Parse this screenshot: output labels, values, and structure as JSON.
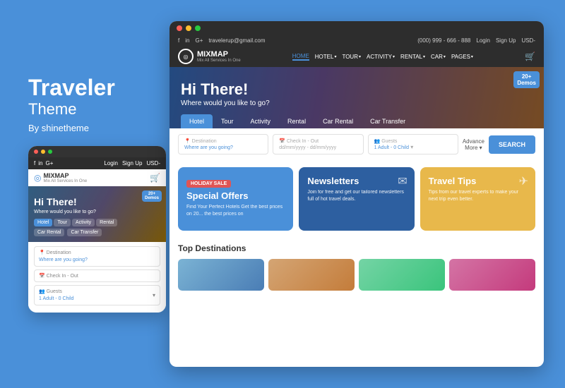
{
  "left": {
    "brand_title": "Traveler",
    "brand_subtitle": "Theme",
    "by_line": "By shinetheme"
  },
  "mobile": {
    "dots": [
      "red",
      "yellow",
      "green"
    ],
    "nav": {
      "social": [
        "f",
        "in",
        "G+"
      ],
      "links": [
        "Login",
        "Sign Up",
        "USD-"
      ]
    },
    "logo": {
      "icon": "◎",
      "name": "MIXMAP",
      "tagline": "Mix All Services In One"
    },
    "hero": {
      "title": "Hi There!",
      "subtitle": "Where would you like to go?",
      "badge_number": "20+",
      "badge_label": "Demos"
    },
    "tabs": [
      "Hotel",
      "Tour",
      "Activity",
      "Rental",
      "Car Rental",
      "Car Transfer"
    ],
    "fields": [
      {
        "label": "Destination",
        "value": "Where are you going?"
      },
      {
        "label": "Check In - Out",
        "value": ""
      },
      {
        "label": "Guests",
        "value": "1 Adult - 0 Child"
      }
    ]
  },
  "desktop": {
    "dots": [
      "red",
      "yellow",
      "green"
    ],
    "top_bar": {
      "left": [
        "f",
        "in",
        "G+",
        "travelerup@gmail.com"
      ],
      "right": [
        "(000) 999 - 666 - 888",
        "Login",
        "Sign Up",
        "USD-"
      ]
    },
    "logo": {
      "icon": "◎",
      "name": "MIXMAP",
      "tagline": "Mix All Services In One"
    },
    "nav": {
      "items": [
        "HOME",
        "HOTEL",
        "TOUR",
        "ACTIVITY",
        "RENTAL",
        "CAR",
        "PAGES"
      ],
      "active": "HOME",
      "dropdowns": [
        "HOTEL",
        "TOUR",
        "ACTIVITY",
        "RENTAL",
        "CAR",
        "PAGES"
      ]
    },
    "cart_icon": "🛒",
    "hero": {
      "title": "Hi There!",
      "subtitle": "Where would you like to go?",
      "badge_number": "20+",
      "badge_label": "Demos"
    },
    "search_tabs": [
      "Hotel",
      "Tour",
      "Activity",
      "Rental",
      "Car Rental",
      "Car Transfer"
    ],
    "active_tab": "Hotel",
    "search_fields": [
      {
        "label": "Destination",
        "placeholder": "Where are you going?",
        "icon": "📍"
      },
      {
        "label": "Check In - Out",
        "placeholder": "dd/mm/yyyy - dd/mm/yyyy",
        "icon": "📅"
      },
      {
        "label": "Guests",
        "placeholder": "1 Adult - 0 Child",
        "icon": "👥"
      }
    ],
    "advance_label": "Advance\nMore ▾",
    "search_button": "SEARCH",
    "cards": [
      {
        "type": "blue",
        "badge": "HOLIDAY SALE",
        "title": "Special Offers",
        "desc": "Find Your Perfect Hotels Get the best prices on 20... the best prices on",
        "icon": ""
      },
      {
        "type": "dark-blue",
        "badge": "",
        "title": "Newsletters",
        "desc": "Join for free and get our tailored newsletters full of hot travel deals.",
        "icon": "✉"
      },
      {
        "type": "yellow",
        "badge": "",
        "title": "Travel Tips",
        "desc": "Tips from our travel experts to make your next trip even better.",
        "icon": "✈"
      }
    ],
    "bottom_section": {
      "title": "Top Destinations",
      "destinations": [
        "dest1",
        "dest2",
        "dest3",
        "dest4"
      ]
    }
  }
}
